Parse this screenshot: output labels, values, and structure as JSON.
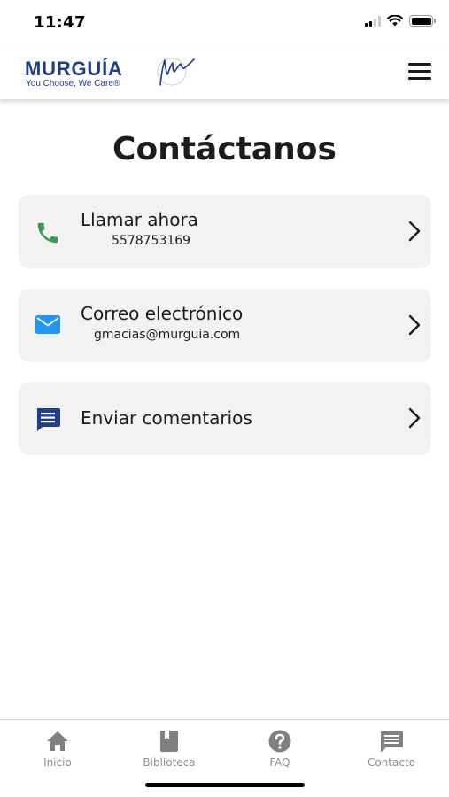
{
  "status_bar": {
    "time": "11:47",
    "icons": [
      "cellular-signal-icon",
      "wifi-icon",
      "battery-icon"
    ]
  },
  "header": {
    "logo_name": "MURGUÍA",
    "logo_tagline": "You Choose, We Care®",
    "menu_icon": "hamburger-menu-icon",
    "brand_color": "#1d3d8f"
  },
  "main": {
    "title": "Contáctanos",
    "cards": [
      {
        "icon": "phone-icon",
        "icon_color": "#3c9a4e",
        "title": "Llamar ahora",
        "subtitle": "5578753169"
      },
      {
        "icon": "email-icon",
        "icon_color": "#2196f3",
        "title": "Correo electrónico",
        "subtitle": "gmacias@murguia.com"
      },
      {
        "icon": "feedback-icon",
        "icon_color": "#1d3d8f",
        "title": "Enviar comentarios"
      }
    ]
  },
  "bottom_nav": {
    "items": [
      {
        "label": "Inicio",
        "icon": "home-icon"
      },
      {
        "label": "Biblioteca",
        "icon": "book-icon"
      },
      {
        "label": "FAQ",
        "icon": "help-icon"
      },
      {
        "label": "Contacto",
        "icon": "chat-icon"
      }
    ],
    "icon_color": "#808080",
    "label_color": "#8e8e8e"
  }
}
